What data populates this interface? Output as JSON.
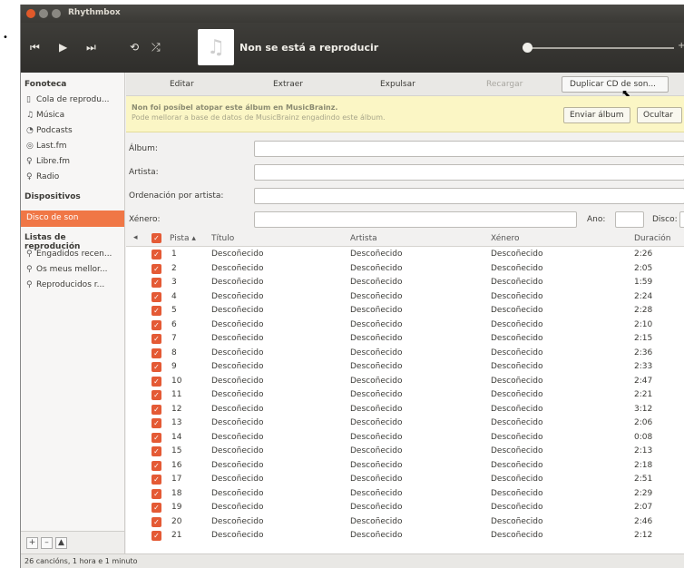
{
  "window": {
    "title": "Rhythmbox"
  },
  "toolbar": {
    "now_playing": "Non se está a reproducir"
  },
  "sidebar": {
    "library_header": "Fonoteca",
    "library_items": [
      "Cola de reprodu...",
      "Música",
      "Podcasts",
      "Last.fm",
      "Libre.fm",
      "Radio"
    ],
    "devices_header": "Dispositivos",
    "device_selected": "Disco de son",
    "playlists_header": "Listas de reprodución",
    "playlists": [
      "Engadidos recen...",
      "Os meus mellor...",
      "Reproducidos r..."
    ],
    "bottom_buttons": [
      "+",
      "–",
      "▲"
    ]
  },
  "actions": {
    "edit": "Editar",
    "extract": "Extraer",
    "eject": "Expulsar",
    "reload": "Recargar",
    "duplicate": "Duplicar CD de son..."
  },
  "info": {
    "title": "Non foi posíbel atopar este álbum en MusicBrainz.",
    "subtitle": "Pode mellorar a base de datos de MusicBrainz engadindo este álbum.",
    "submit": "Enviar álbum",
    "hide": "Ocultar"
  },
  "form": {
    "album": "Álbum:",
    "artist": "Artista:",
    "artist_sort": "Ordenación por artista:",
    "genre": "Xénero:",
    "year": "Ano:",
    "disc": "Disco:"
  },
  "table": {
    "headers": {
      "track": "Pista",
      "title": "Título",
      "artist": "Artista",
      "genre": "Xénero",
      "duration": "Duración"
    },
    "unknown": "Descoñecido",
    "rows": [
      {
        "n": "1",
        "d": "2:26"
      },
      {
        "n": "2",
        "d": "2:05"
      },
      {
        "n": "3",
        "d": "1:59"
      },
      {
        "n": "4",
        "d": "2:24"
      },
      {
        "n": "5",
        "d": "2:28"
      },
      {
        "n": "6",
        "d": "2:10"
      },
      {
        "n": "7",
        "d": "2:15"
      },
      {
        "n": "8",
        "d": "2:36"
      },
      {
        "n": "9",
        "d": "2:33"
      },
      {
        "n": "10",
        "d": "2:47"
      },
      {
        "n": "11",
        "d": "2:21"
      },
      {
        "n": "12",
        "d": "3:12"
      },
      {
        "n": "13",
        "d": "2:06"
      },
      {
        "n": "14",
        "d": "0:08"
      },
      {
        "n": "15",
        "d": "2:13"
      },
      {
        "n": "16",
        "d": "2:18"
      },
      {
        "n": "17",
        "d": "2:51"
      },
      {
        "n": "18",
        "d": "2:29"
      },
      {
        "n": "19",
        "d": "2:07"
      },
      {
        "n": "20",
        "d": "2:46"
      },
      {
        "n": "21",
        "d": "2:12"
      }
    ]
  },
  "status": "26 cancións, 1 hora e 1 minuto"
}
